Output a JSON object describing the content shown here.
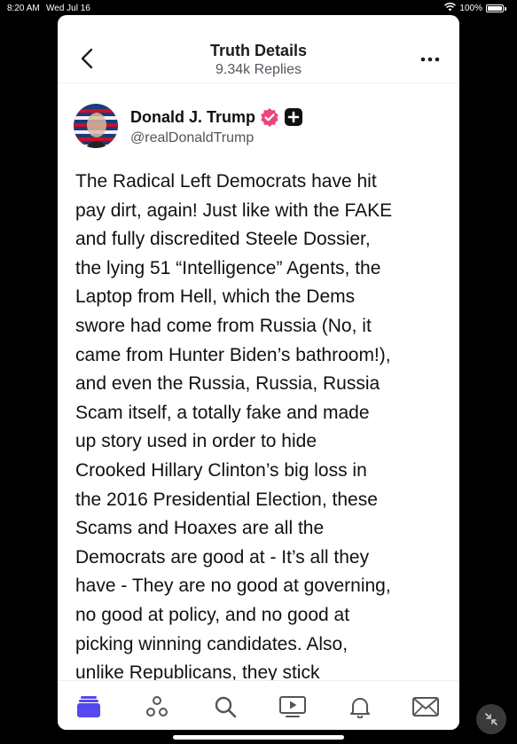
{
  "status_bar": {
    "time": "8:20 AM",
    "date": "Wed Jul 16",
    "battery": "100%"
  },
  "header": {
    "title": "Truth Details",
    "subtitle": "9.34k Replies"
  },
  "post": {
    "author_name": "Donald J. Trump",
    "handle": "@realDonaldTrump",
    "body_lines": [
      "The Radical Left Democrats have hit",
      "pay dirt, again! Just like with the FAKE",
      "and fully discredited Steele Dossier,",
      "the lying 51 “Intelligence” Agents, the",
      "Laptop from Hell, which the Dems",
      "swore had come from Russia (No, it",
      "came from Hunter Biden’s bathroom!),",
      "and even the Russia, Russia, Russia",
      "Scam itself, a totally fake and made",
      "up story used in order to hide",
      "Crooked Hillary Clinton’s big loss in",
      "the 2016 Presidential Election, these",
      "Scams and Hoaxes are all the",
      "Democrats are good at - It’s all they",
      "have - They are no good at governing,",
      "no good at policy, and no good at",
      "picking winning candidates. Also,",
      "unlike Republicans, they stick"
    ]
  },
  "tabbar": {
    "tabs": [
      "feed-icon",
      "groups-icon",
      "search-icon",
      "video-icon",
      "notifications-icon",
      "messages-icon"
    ],
    "active_color": "#5448ee"
  },
  "colors": {
    "verified_badge": "#e8467c",
    "plus_badge": "#111111"
  }
}
